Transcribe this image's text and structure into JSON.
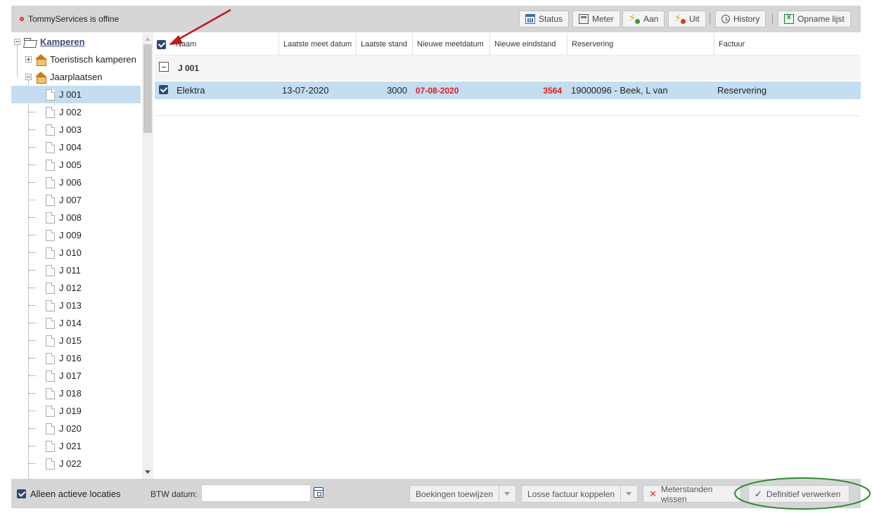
{
  "status": {
    "offline_text": "TommyServices is offine"
  },
  "toolbar": {
    "status_label": "Status",
    "meter_label": "Meter",
    "aan_label": "Aan",
    "uit_label": "Uit",
    "history_label": "History",
    "opname_label": "Opname lijst"
  },
  "tree": {
    "root": "Kamperen",
    "groups": [
      "Toeristisch kamperen",
      "Jaarplaatsen"
    ],
    "items": [
      "J 001",
      "J 002",
      "J 003",
      "J 004",
      "J 005",
      "J 006",
      "J 007",
      "J 008",
      "J 009",
      "J 010",
      "J 011",
      "J 012",
      "J 013",
      "J 014",
      "J 015",
      "J 016",
      "J 017",
      "J 018",
      "J 019",
      "J 020",
      "J 021",
      "J 022"
    ],
    "selected": "J 001"
  },
  "grid": {
    "columns": [
      "Naam",
      "Laatste meet datum",
      "Laatste stand",
      "Nieuwe meetdatum",
      "Nieuwe eindstand",
      "Reservering",
      "Factuur"
    ],
    "group_label": "J 001",
    "row": {
      "naam": "Elektra",
      "laatste_meet_datum": "13-07-2020",
      "laatste_stand": "3000",
      "nieuwe_meetdatum": "07-08-2020",
      "nieuwe_eindstand": "3564",
      "reservering": "19000096 - Beek, L van",
      "factuur": "Reservering"
    }
  },
  "bottom": {
    "alleen_actieve": "Alleen actieve locaties",
    "btw_label": "BTW datum:",
    "btw_value": "",
    "boekingen_label": "Boekingen toewijzen",
    "losse_label": "Losse factuur koppelen",
    "wissen_label": "Meterstanden wissen",
    "verwerken_label": "Definitief verwerken"
  },
  "colors": {
    "selection": "#c4ddf0",
    "checkbox": "#2c4a6e",
    "highlight_red": "#e01b1b",
    "annotation_arrow": "#c0181c",
    "annotation_ellipse": "#2f8a2f"
  }
}
